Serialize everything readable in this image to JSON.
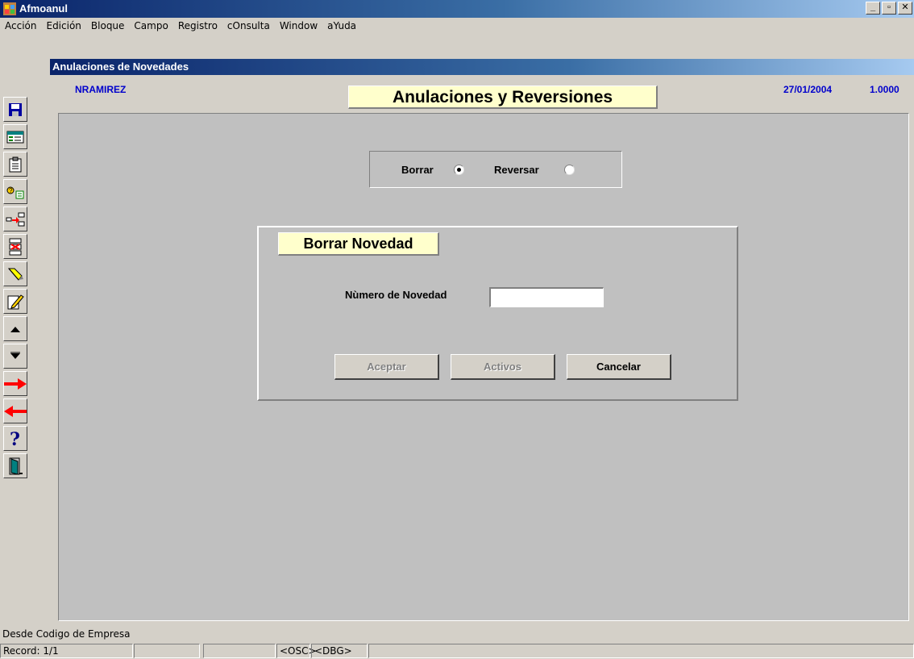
{
  "window": {
    "title": "Afmoanul",
    "minimize": "_",
    "maximize": "▫",
    "close": "✕"
  },
  "menu": [
    "Acción",
    "Edición",
    "Bloque",
    "Campo",
    "Registro",
    "cOnsulta",
    "Window",
    "aYuda"
  ],
  "toolbar": {
    "icons": [
      "save-icon",
      "list-values-icon",
      "clipboard-icon",
      "query-icon",
      "insert-record-icon",
      "delete-record-icon",
      "clear-icon",
      "edit-icon",
      "previous-record-icon",
      "next-record-icon",
      "next-block-icon",
      "previous-block-icon",
      "help-icon",
      "exit-icon"
    ]
  },
  "inner_window": {
    "title": "Anulaciones de Novedades",
    "user": "NRAMIREZ",
    "form_title": "Anulaciones y Reversiones",
    "date": "27/01/2004",
    "version": "1.0000"
  },
  "mode": {
    "options": [
      {
        "label": "Borrar",
        "selected": true
      },
      {
        "label": "Reversar",
        "selected": false
      }
    ]
  },
  "panel": {
    "title": "Borrar Novedad",
    "field_label": "Nùmero de Novedad",
    "field_value": "",
    "buttons": [
      {
        "label": "Aceptar",
        "enabled": false
      },
      {
        "label": "Activos",
        "enabled": false
      },
      {
        "label": "Cancelar",
        "enabled": true
      }
    ]
  },
  "status": {
    "hint": "Desde Codigo de Empresa",
    "record": "Record: 1/1",
    "osc": "<OSC>",
    "dbg": "<DBG>"
  }
}
